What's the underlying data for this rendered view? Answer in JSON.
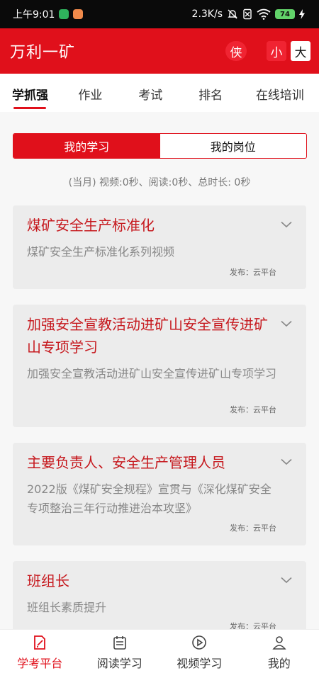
{
  "statusbar": {
    "time": "上午9:01",
    "speed": "2.3K/s",
    "battery": "74"
  },
  "appbar": {
    "title": "万利一矿",
    "chip_xia": "侠",
    "font_small": "小",
    "font_big": "大"
  },
  "tabs": [
    {
      "label": "学抓强"
    },
    {
      "label": "作业"
    },
    {
      "label": "考试"
    },
    {
      "label": "排名"
    },
    {
      "label": "在线培训"
    }
  ],
  "segmented": {
    "left": "我的学习",
    "right": "我的岗位"
  },
  "summary": "(当月) 视频:0秒、阅读:0秒、总时长: 0秒",
  "cards": [
    {
      "title": "煤矿安全生产标准化",
      "desc": "煤矿安全生产标准化系列视频",
      "publisher": "发布：云平台"
    },
    {
      "title": "加强安全宣教活动进矿山安全宣传进矿山专项学习",
      "desc": "加强安全宣教活动进矿山安全宣传进矿山专项学习",
      "publisher": "发布：云平台"
    },
    {
      "title": "主要负责人、安全生产管理人员",
      "desc": "2022版《煤矿安全规程》宣贯与《深化煤矿安全专项整治三年行动推进治本攻坚》",
      "publisher": "发布：云平台"
    },
    {
      "title": "班组长",
      "desc": "班组长素质提升",
      "publisher": "发布：云平台"
    }
  ],
  "bottomnav": [
    {
      "label": "学考平台"
    },
    {
      "label": "阅读学习"
    },
    {
      "label": "视频学习"
    },
    {
      "label": "我的"
    }
  ],
  "colors": {
    "primary": "#e0101b",
    "card_title": "#c6191e",
    "card_bg": "#ececec"
  }
}
